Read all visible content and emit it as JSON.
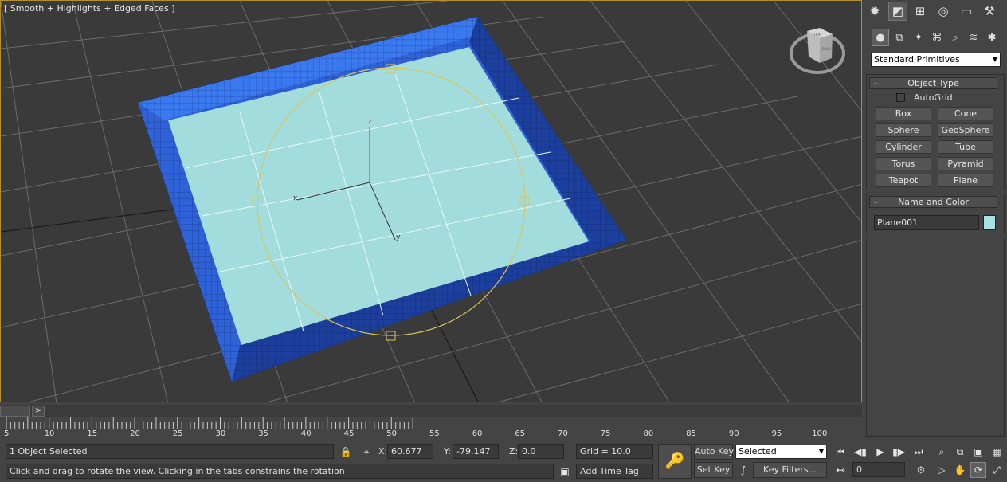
{
  "viewport": {
    "label": "[ Smooth + Highlights + Edged Faces ]",
    "axes": {
      "x": "x",
      "y": "y",
      "z": "z"
    },
    "viewcube": {
      "top_label": "TOP",
      "front_label": "BACK"
    }
  },
  "command_panel": {
    "tabs": [
      "create-icon",
      "modify-icon",
      "hierarchy-icon",
      "motion-icon",
      "display-icon",
      "utilities-icon"
    ],
    "subtabs": [
      "geometry-icon",
      "shapes-icon",
      "lights-icon",
      "cameras-icon",
      "helpers-icon",
      "spacewarps-icon",
      "systems-icon"
    ],
    "category_dropdown": "Standard Primitives",
    "object_type": {
      "title": "Object Type",
      "minus": "-",
      "autogrid_label": "AutoGrid",
      "buttons": [
        "Box",
        "Cone",
        "Sphere",
        "GeoSphere",
        "Cylinder",
        "Tube",
        "Torus",
        "Pyramid",
        "Teapot",
        "Plane"
      ]
    },
    "name_and_color": {
      "title": "Name and Color",
      "minus": "-",
      "name_value": "Plane001",
      "swatch_color": "#a8e2e2"
    }
  },
  "timeline": {
    "slider_arrow": ">",
    "ticks": [
      "5",
      "10",
      "15",
      "20",
      "25",
      "30",
      "35",
      "40",
      "45",
      "50",
      "55",
      "60",
      "65",
      "70",
      "75",
      "80",
      "85",
      "90",
      "95",
      "100"
    ]
  },
  "status_bar": {
    "selection": "1 Object Selected",
    "prompt": "Click and drag to rotate the view.  Clicking in the tabs constrains the rotation",
    "x_label": "X:",
    "x_value": "60.677",
    "y_label": "Y:",
    "y_value": "-79.147",
    "z_label": "Z:",
    "z_value": "0.0",
    "grid": "Grid = 10.0",
    "add_time_tag": "Add Time Tag",
    "auto_key": "Auto Key",
    "set_key": "Set Key",
    "key_mode_dropdown": "Selected",
    "key_filters": "Key Filters...",
    "frame_value": "0"
  },
  "colors": {
    "viewport_bg": "#3a3a3a",
    "panel_bg": "#444444",
    "frame_blue": "#2f64d8",
    "plane_fill": "#a3dcdd",
    "gizmo_yellow": "#d8c65a",
    "active_border": "#b0902a"
  }
}
